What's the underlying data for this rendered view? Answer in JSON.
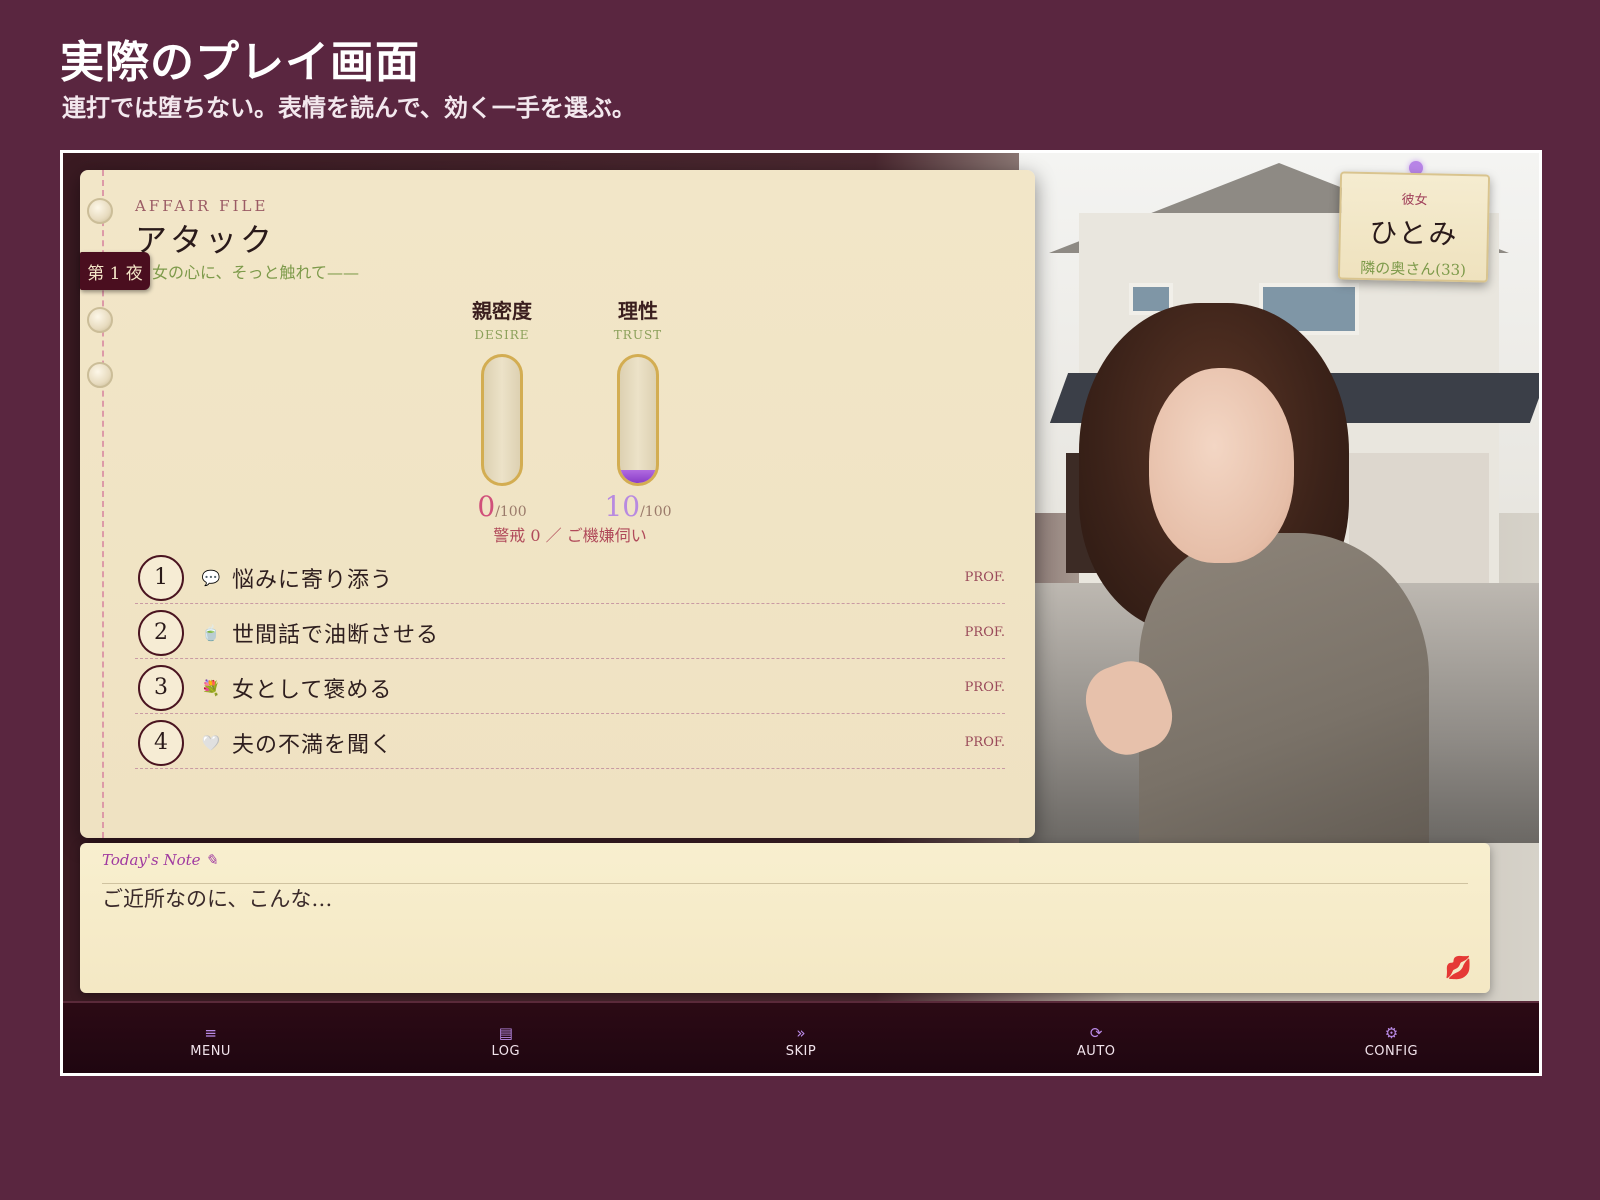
{
  "promo": {
    "title": "実際のプレイ画面",
    "subtitle": "連打では堕ちない。表情を読んで、効く一手を選ぶ。"
  },
  "notebook": {
    "night_tab": "第 1 夜",
    "file_label": "AFFAIR FILE",
    "title": "アタック",
    "tagline": "女の心に、そっと触れて——"
  },
  "gauges": [
    {
      "name": "親密度",
      "sub": "DESIRE",
      "value": 0,
      "value_text": "0",
      "max_text": "/100",
      "color": "#d0507a"
    },
    {
      "name": "理性",
      "sub": "TRUST",
      "value": 10,
      "value_text": "10",
      "max_text": "/100",
      "color": "#b88ae0"
    }
  ],
  "caution": "警戒 0 ／ ご機嫌伺い",
  "choices": [
    {
      "num": "1",
      "icon": "speech-bubble-icon",
      "glyph": "💬",
      "label": "悩みに寄り添う",
      "tag": "PROF."
    },
    {
      "num": "2",
      "icon": "tea-cup-icon",
      "glyph": "🍵",
      "label": "世間話で油断させる",
      "tag": "PROF."
    },
    {
      "num": "3",
      "icon": "bouquet-icon",
      "glyph": "💐",
      "label": "女として褒める",
      "tag": "PROF."
    },
    {
      "num": "4",
      "icon": "white-heart-icon",
      "glyph": "🤍",
      "label": "夫の不満を聞く",
      "tag": "PROF."
    }
  ],
  "her": {
    "label": "彼女",
    "name": "ひとみ",
    "desc": "隣の奥さん(33)"
  },
  "note": {
    "title": "Today's Note ✎",
    "text": "ご近所なのに、こんな…",
    "kiss_glyph": "💋"
  },
  "bottom_bar": [
    {
      "icon": "menu-icon",
      "glyph": "≡",
      "label": "MENU"
    },
    {
      "icon": "log-icon",
      "glyph": "▤",
      "label": "LOG"
    },
    {
      "icon": "skip-icon",
      "glyph": "»",
      "label": "SKIP"
    },
    {
      "icon": "auto-icon",
      "glyph": "⟳",
      "label": "AUTO"
    },
    {
      "icon": "config-icon",
      "glyph": "⚙",
      "label": "CONFIG"
    }
  ]
}
